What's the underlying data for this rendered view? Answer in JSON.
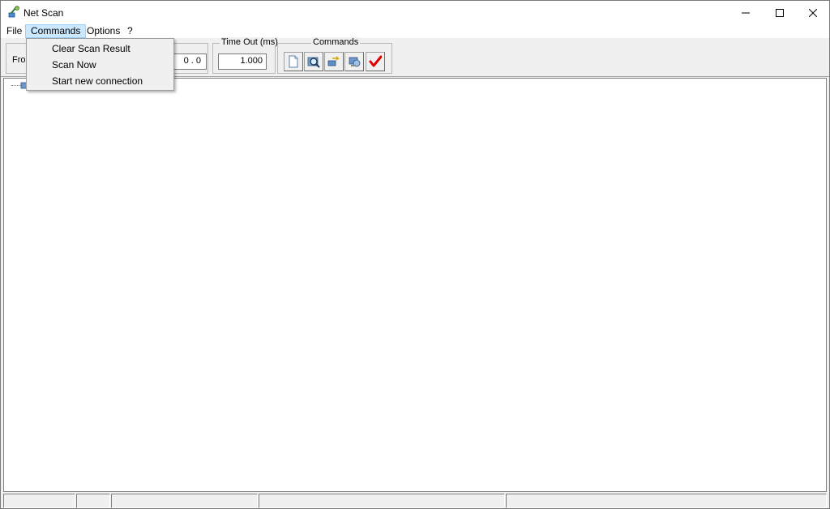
{
  "window": {
    "title": "Net Scan",
    "icon": "network-scan-icon"
  },
  "menubar": {
    "items": [
      "File",
      "Commands",
      "Options",
      "?"
    ]
  },
  "toolbar": {
    "from_label": "From",
    "ip_value": "0  .  0",
    "timeout_label": "Time Out (ms)",
    "timeout_value": "1.000",
    "commands_label": "Commands",
    "buttons": [
      "new-document-icon",
      "search-icon",
      "connect-icon",
      "network-icon",
      "checkmark-icon"
    ]
  },
  "dropdown": {
    "items": [
      "Clear Scan Result",
      "Scan Now",
      "Start new connection"
    ]
  },
  "colors": {
    "menu_highlight": "#cce8ff",
    "check_red": "#e00000"
  }
}
